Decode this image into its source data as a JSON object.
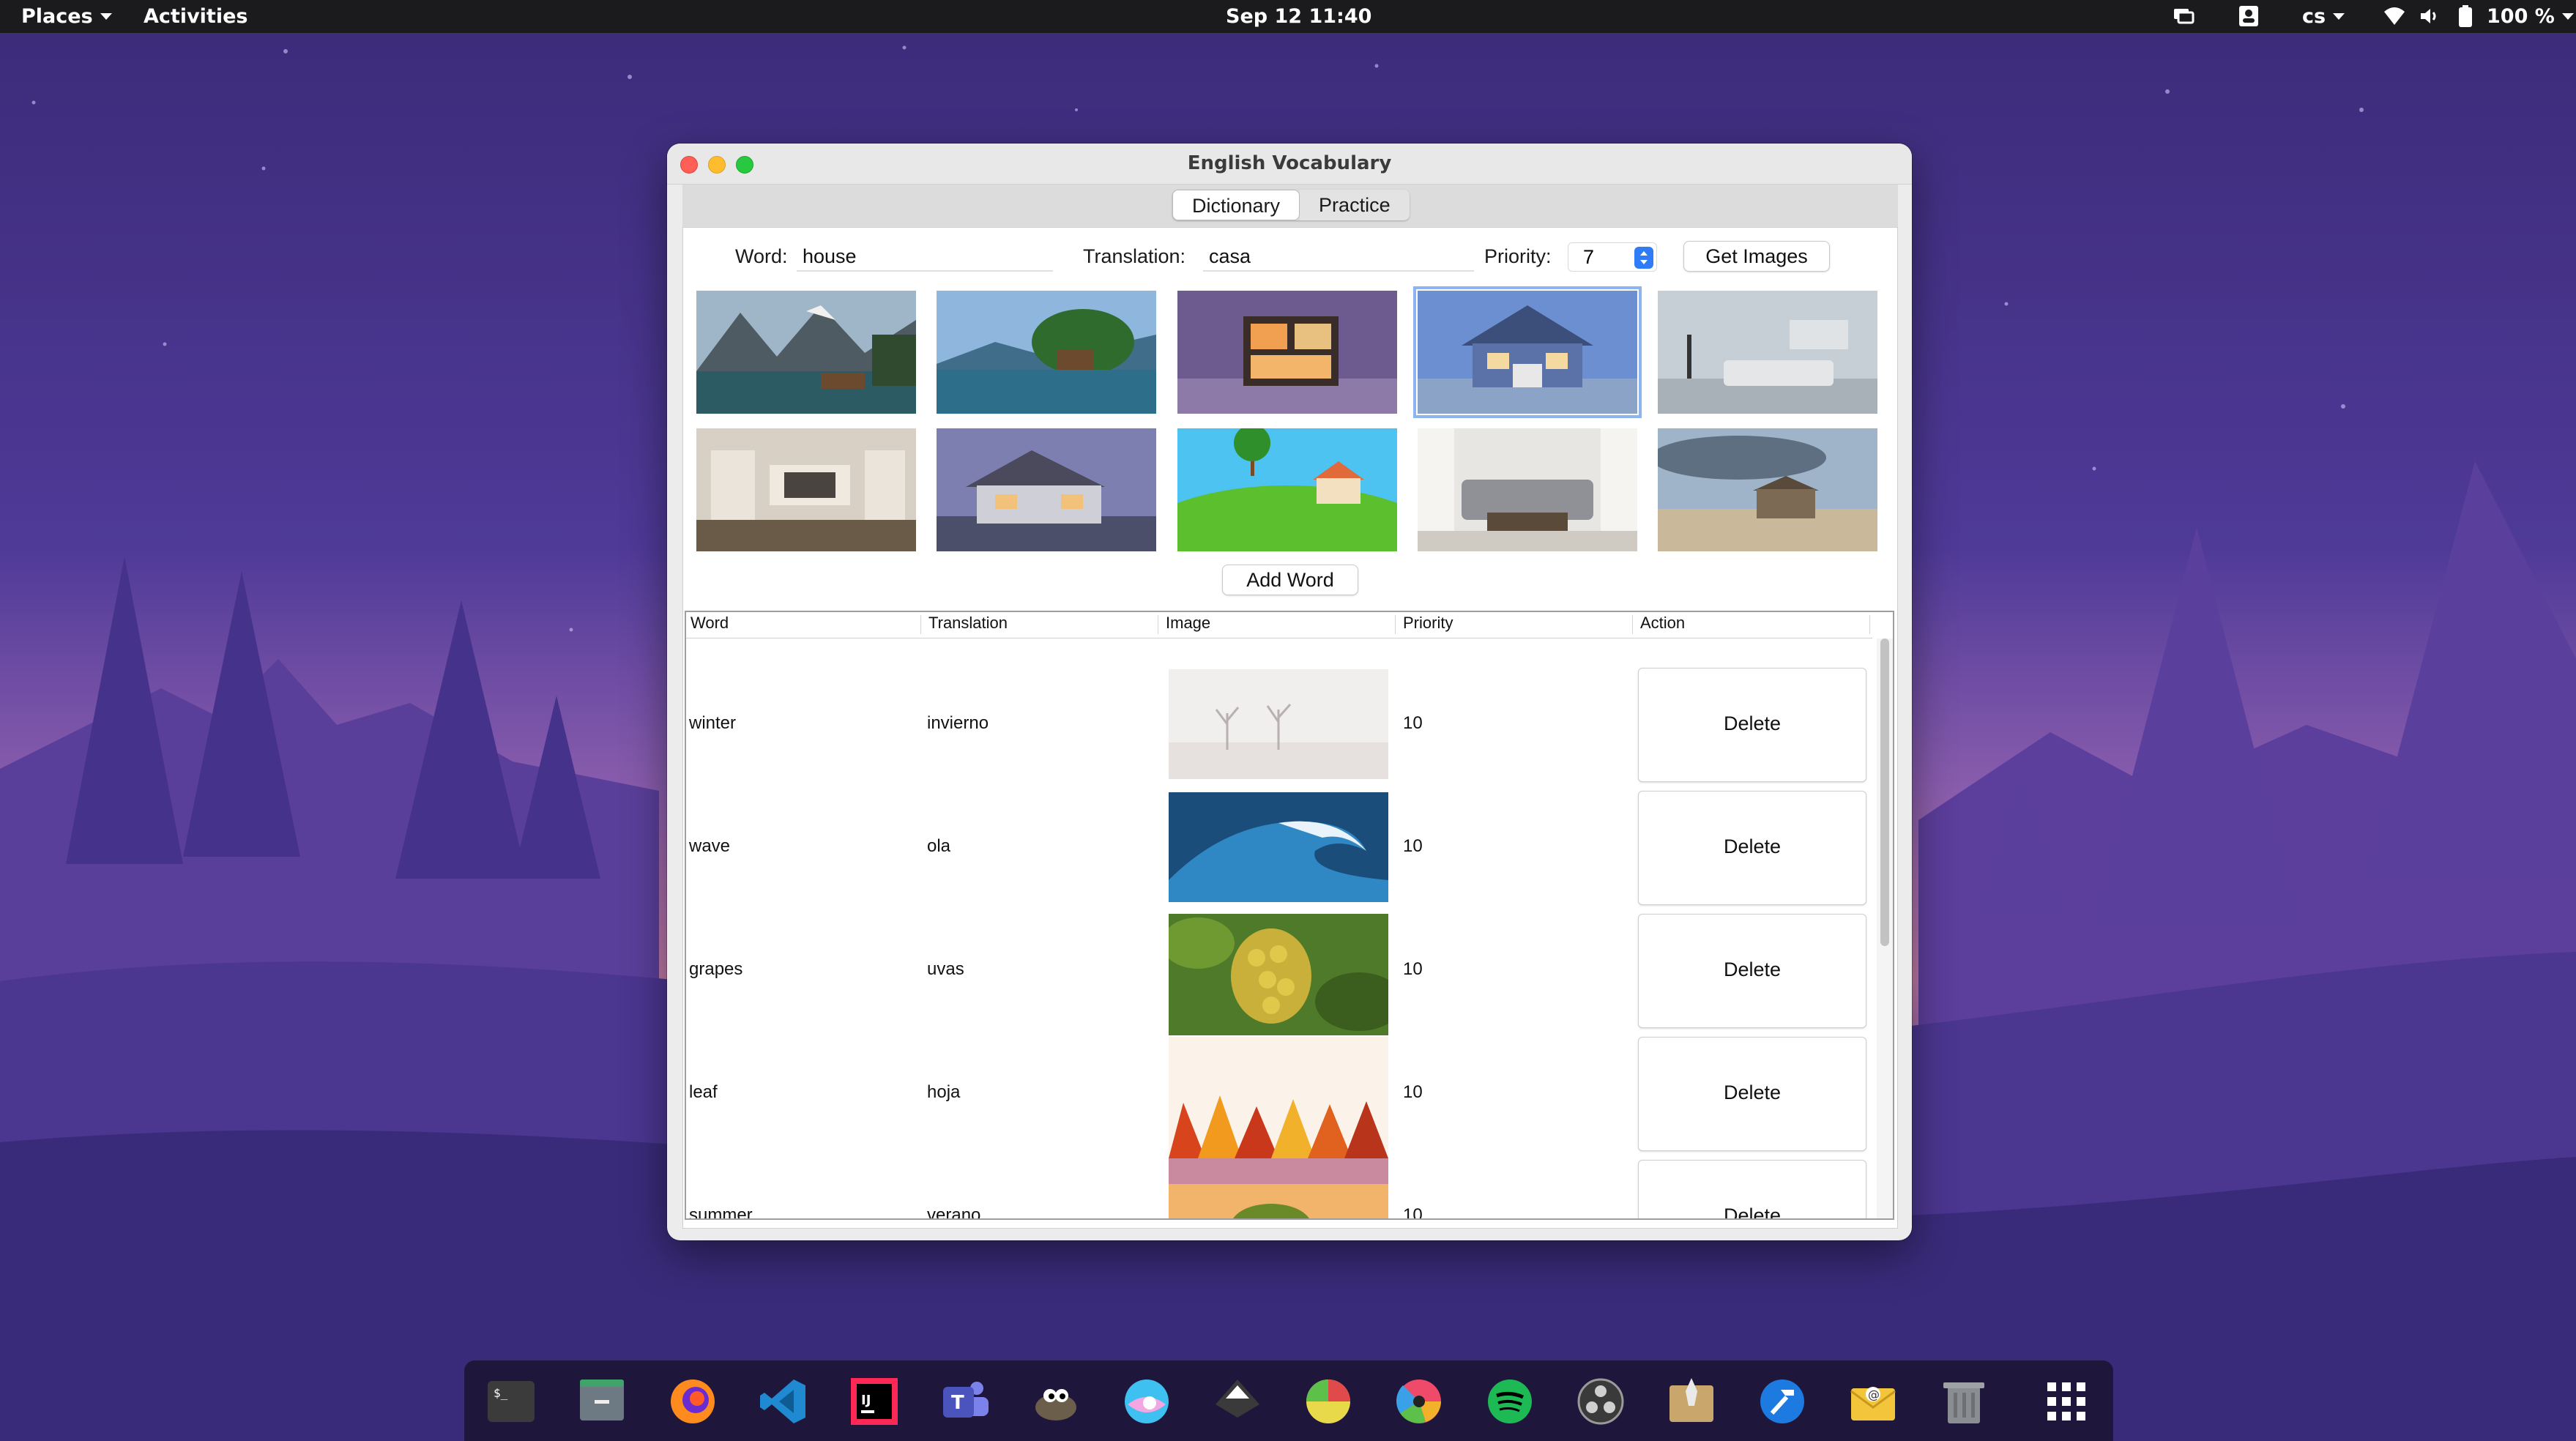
{
  "topbar": {
    "places_label": "Places",
    "activities_label": "Activities",
    "datetime": "Sep 12  11:40",
    "input_language": "cs",
    "battery_percent": "100 %"
  },
  "window": {
    "title": "English Vocabulary",
    "tabs": [
      {
        "label": "Dictionary",
        "active": true
      },
      {
        "label": "Practice",
        "active": false
      }
    ],
    "form": {
      "word_label": "Word:",
      "word_value": "house",
      "translation_label": "Translation:",
      "translation_value": "casa",
      "priority_label": "Priority:",
      "priority_value": "7",
      "get_images_label": "Get Images",
      "add_word_label": "Add Word"
    },
    "image_results": [
      {
        "icon": "mountain-lake-cabin-image",
        "selected": false
      },
      {
        "icon": "lake-boathouse-image",
        "selected": false
      },
      {
        "icon": "modern-house-night-image",
        "selected": false
      },
      {
        "icon": "blue-family-house-image",
        "selected": true
      },
      {
        "icon": "living-room-image",
        "selected": false
      },
      {
        "icon": "interior-tv-room-image",
        "selected": false
      },
      {
        "icon": "suburban-house-dusk-image",
        "selected": false
      },
      {
        "icon": "cartoon-house-hill-image",
        "selected": false
      },
      {
        "icon": "grey-sofa-room-image",
        "selected": false
      },
      {
        "icon": "desert-wooden-house-image",
        "selected": false
      }
    ],
    "table": {
      "headers": [
        "Word",
        "Translation",
        "Image",
        "Priority",
        "Action"
      ],
      "rows": [
        {
          "word": "winter",
          "translation": "invierno",
          "image_icon": "winter-trees-image",
          "priority": "10",
          "action": "Delete"
        },
        {
          "word": "wave",
          "translation": "ola",
          "image_icon": "ocean-wave-image",
          "priority": "10",
          "action": "Delete"
        },
        {
          "word": "grapes",
          "translation": "uvas",
          "image_icon": "grapes-image",
          "priority": "10",
          "action": "Delete"
        },
        {
          "word": "leaf",
          "translation": "hoja",
          "image_icon": "autumn-leaves-image",
          "priority": "10",
          "action": "Delete"
        },
        {
          "word": "summer",
          "translation": "verano",
          "image_icon": "summer-sunset-image",
          "priority": "10",
          "action": "Delete"
        }
      ]
    }
  },
  "dock": {
    "apps": [
      "terminal-icon",
      "files-icon",
      "firefox-icon",
      "vscode-icon",
      "intellij-icon",
      "teams-icon",
      "gimp-icon",
      "color-picker-icon",
      "inkscape-icon",
      "pie-app-icon",
      "aperture-icon",
      "spotify-icon",
      "obs-icon",
      "app-installer-icon",
      "xcode-hammer-icon",
      "mail-icon",
      "trash-icon",
      "app-grid-icon"
    ]
  },
  "colors": {
    "accent": "#2f7cf6",
    "selection_outline": "#8cb4f0",
    "topbar_bg": "#1b1b1d"
  }
}
